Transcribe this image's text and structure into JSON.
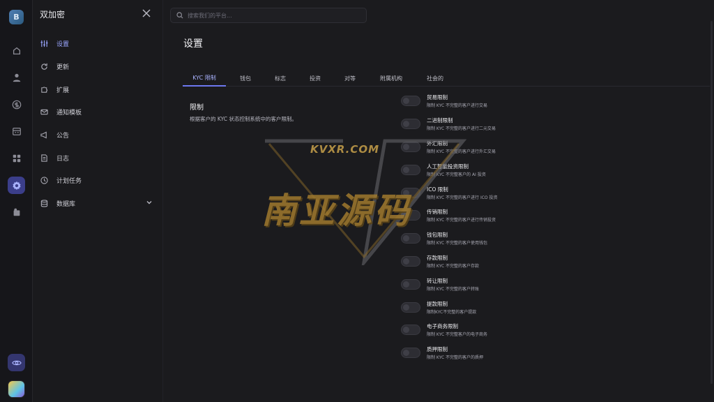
{
  "rail": {
    "logo_letter": "B",
    "icons": [
      "home-icon",
      "user-icon",
      "dollar-icon",
      "calendar-icon",
      "grid-icon",
      "settings-icon",
      "badge-icon"
    ],
    "bottom_icon": "eye-icon"
  },
  "menu": {
    "title": "双加密",
    "items": [
      {
        "label": "设置",
        "icon": "sliders-icon",
        "active": true
      },
      {
        "label": "更新",
        "icon": "refresh-icon"
      },
      {
        "label": "扩展",
        "icon": "puzzle-icon"
      },
      {
        "label": "通知模板",
        "icon": "mail-icon"
      },
      {
        "label": "公告",
        "icon": "megaphone-icon"
      },
      {
        "label": "日志",
        "icon": "log-icon"
      },
      {
        "label": "计划任务",
        "icon": "clock-icon"
      },
      {
        "label": "数据库",
        "icon": "database-icon",
        "expandable": true
      }
    ]
  },
  "search": {
    "placeholder": "搜索我们的平台..."
  },
  "page": {
    "title": "设置"
  },
  "tabs": [
    "KYC 限制",
    "钱包",
    "标志",
    "投资",
    "对等",
    "附属机构",
    "社会的"
  ],
  "section": {
    "title": "限制",
    "description": "根据客户的 KYC 状态控制系统中的客户限制。"
  },
  "options": [
    {
      "title": "贸易限制",
      "desc": "限制 KYC 不完整的客户进行交易"
    },
    {
      "title": "二进制限制",
      "desc": "限制 KYC 不完整的客户进行二元交易"
    },
    {
      "title": "外汇限制",
      "desc": "限制 KYC 不完整的客户进行外汇交易"
    },
    {
      "title": "人工智能投资限制",
      "desc": "限制 KYC 不完整客户的 AI 投资"
    },
    {
      "title": "ICO 限制",
      "desc": "限制 KYC 不完整的客户进行 ICO 投资"
    },
    {
      "title": "传销限制",
      "desc": "限制 KYC 不完整的客户进行传销投资"
    },
    {
      "title": "钱包限制",
      "desc": "限制 KYC 不完整的客户使用钱包"
    },
    {
      "title": "存款限制",
      "desc": "限制 KYC 不完整的客户存款"
    },
    {
      "title": "转让限制",
      "desc": "限制 KYC 不完整的客户转账"
    },
    {
      "title": "提款限制",
      "desc": "限制KYC不完整的客户提款"
    },
    {
      "title": "电子商务限制",
      "desc": "限制 KYC 不完整客户的电子商务"
    },
    {
      "title": "质押限制",
      "desc": "限制 KYC 不完整的客户的质押"
    }
  ],
  "watermark": {
    "url_text": "KVXR.COM",
    "brand_text": "南亚源码"
  },
  "colors": {
    "accent": "#6d78f0",
    "active_text": "#9aa6ff",
    "bg": "#1b1b1e"
  }
}
